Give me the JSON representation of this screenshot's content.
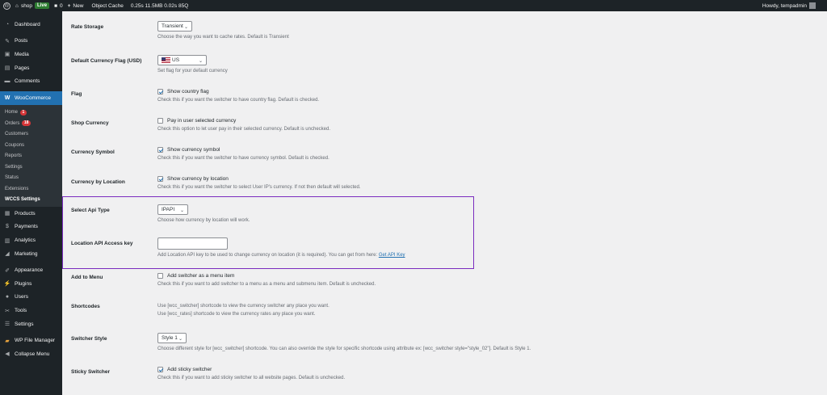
{
  "adminbar": {
    "site_name": "shop",
    "live_badge": "Live",
    "comments_count": "0",
    "new_label": "New",
    "object_cache": "Object Cache",
    "perf_stats": "0.25s  11.5MB  0.02s  85Q",
    "howdy": "Howdy, tempadmin"
  },
  "sidebar": {
    "dashboard": "Dashboard",
    "posts": "Posts",
    "media": "Media",
    "pages": "Pages",
    "comments": "Comments",
    "woocommerce": "WooCommerce",
    "sub": {
      "home": "Home",
      "home_count": "1",
      "orders": "Orders",
      "orders_count": "18",
      "customers": "Customers",
      "coupons": "Coupons",
      "reports": "Reports",
      "settings": "Settings",
      "status": "Status",
      "extensions": "Extensions",
      "wccs_settings": "WCCS Settings"
    },
    "products": "Products",
    "payments": "Payments",
    "analytics": "Analytics",
    "marketing": "Marketing",
    "appearance": "Appearance",
    "plugins": "Plugins",
    "users": "Users",
    "tools": "Tools",
    "settings": "Settings",
    "wp_file_manager": "WP File Manager",
    "collapse_menu": "Collapse Menu"
  },
  "settings": {
    "rate_storage": {
      "label": "Rate Storage",
      "value": "Transient",
      "desc": "Choose the way you want to cache rates. Default is Transient"
    },
    "currency_flag": {
      "label": "Default Currency Flag (USD)",
      "value": "US",
      "desc": "Set flag for your default currency"
    },
    "flag": {
      "label": "Flag",
      "checkbox": "Show country flag",
      "checked": true,
      "desc": "Check this if you want the switcher to have country flag. Default is checked."
    },
    "shop_currency": {
      "label": "Shop Currency",
      "checkbox": "Pay in user selected currency",
      "checked": false,
      "desc": "Check this option to let user pay in their selected currency. Default is unchecked."
    },
    "currency_symbol": {
      "label": "Currency Symbol",
      "checkbox": "Show currency symbol",
      "checked": true,
      "desc": "Check this if you want the switcher to have currency symbol. Default is checked."
    },
    "currency_by_location": {
      "label": "Currency by Location",
      "checkbox": "Show currency by location",
      "checked": true,
      "desc": "Check this if you want the switcher to select User IP's currency. If not then default will selected."
    },
    "api_type": {
      "label": "Select Api Type",
      "value": "IPAPI",
      "desc": "Choose how currency by location will work."
    },
    "api_key": {
      "label": "Location API Access key",
      "value": "",
      "desc": "Add Location API key to be used to change currency on location (it is required). You can get from here:",
      "link": "Get API Key"
    },
    "add_to_menu": {
      "label": "Add to Menu",
      "checkbox": "Add switcher as a menu item",
      "checked": false,
      "desc": "Check this if you want to add switcher to a menu as a menu and submenu item. Default is unchecked."
    },
    "shortcodes": {
      "label": "Shortcodes",
      "line1": "Use [wcc_switcher] shortcode to view the currency switcher any place you want.",
      "line2": "Use [wcc_rates] shortcode to view the currency rates any place you want."
    },
    "switcher_style": {
      "label": "Switcher Style",
      "value": "Style 1",
      "desc": "Choose different style for [wcc_switcher] shortcode. You can also override the style for specific shortcode using attribute ex: [wcc_switcher style=\"style_02\"]. Default is Style 1."
    },
    "sticky_switcher": {
      "label": "Sticky Switcher",
      "checkbox": "Add sticky switcher",
      "checked": true,
      "desc": "Check this if you want to add sticky switcher to all website pages. Default is unchecked."
    }
  }
}
